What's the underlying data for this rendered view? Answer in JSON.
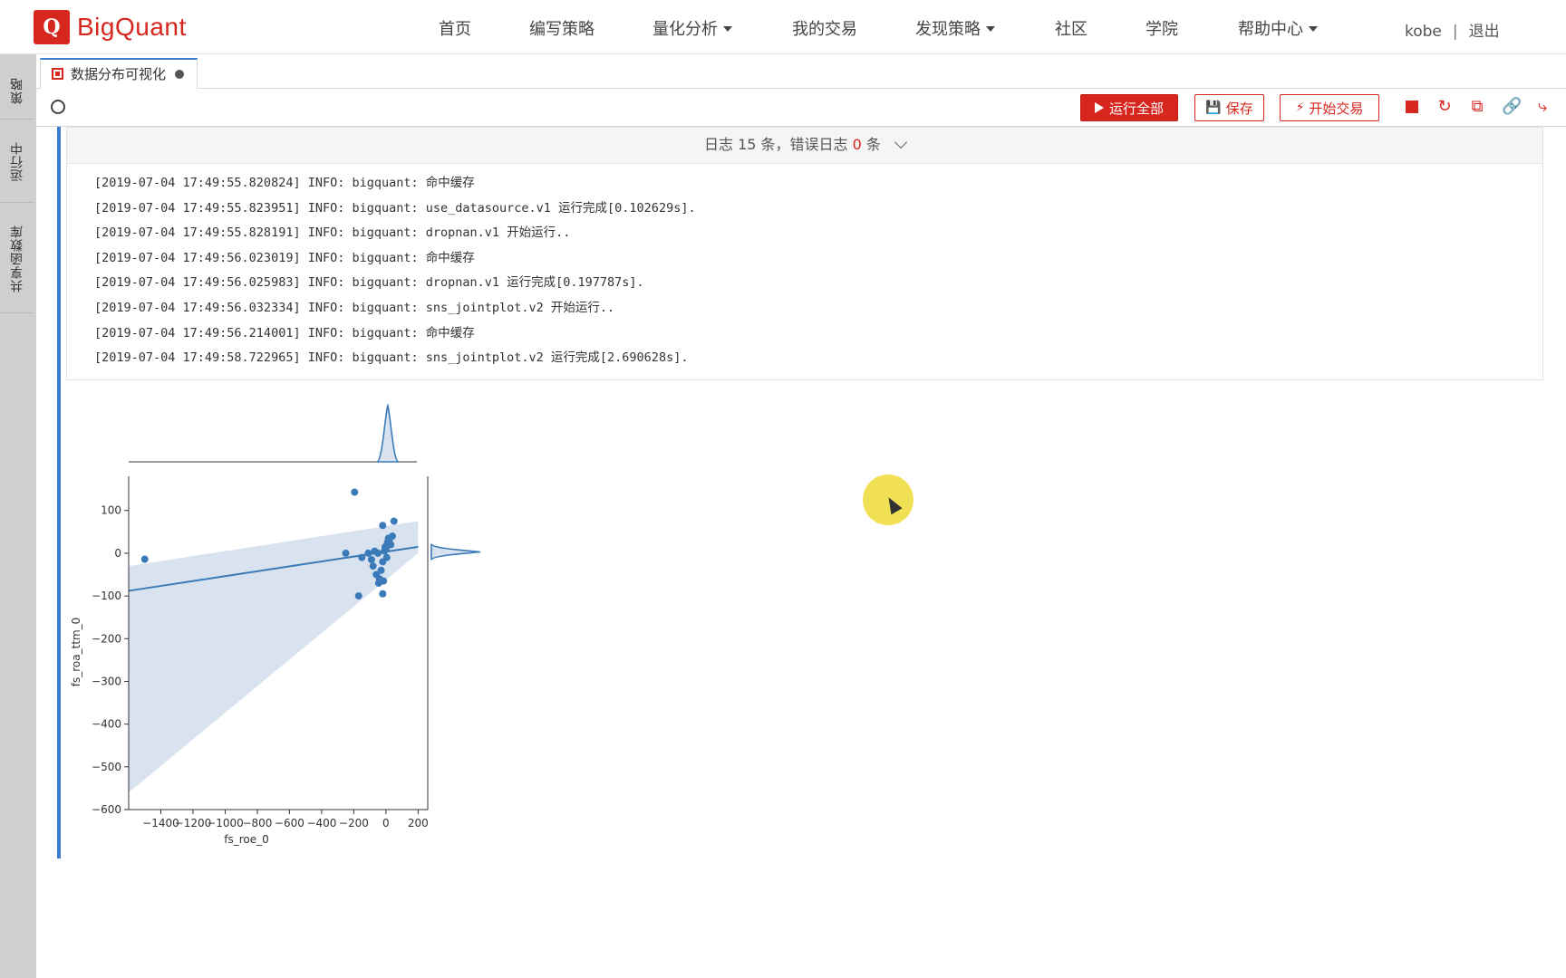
{
  "brand": {
    "logo_letter": "Q",
    "name": "BigQuant",
    "color": "#d7261e"
  },
  "nav": {
    "items": [
      {
        "label": "首页",
        "has_dropdown": false
      },
      {
        "label": "编写策略",
        "has_dropdown": false
      },
      {
        "label": "量化分析",
        "has_dropdown": true
      },
      {
        "label": "我的交易",
        "has_dropdown": false
      },
      {
        "label": "发现策略",
        "has_dropdown": true
      },
      {
        "label": "社区",
        "has_dropdown": false
      },
      {
        "label": "学院",
        "has_dropdown": false
      },
      {
        "label": "帮助中心",
        "has_dropdown": true
      }
    ],
    "user": "kobe",
    "separator": "|",
    "logout": "退出"
  },
  "sidebar": {
    "tabs": [
      {
        "label": "策略"
      },
      {
        "label": "运行中"
      },
      {
        "label": "共享函数库"
      }
    ]
  },
  "editor": {
    "tab_name": "数据分布可视化",
    "unsaved_dot": true
  },
  "toolbar": {
    "run_all": "运行全部",
    "save": "保存",
    "start_trade": "开始交易",
    "icons": [
      "stop-icon",
      "refresh-icon",
      "copy-icon",
      "link-icon",
      "share-icon"
    ]
  },
  "log": {
    "prefix": "日志",
    "count": "15",
    "count_unit": "条，错误日志",
    "error_count": "0",
    "error_unit": "条",
    "lines": [
      "[2019-07-04 17:49:55.820824] INFO: bigquant: 命中缓存",
      "[2019-07-04 17:49:55.823951] INFO: bigquant: use_datasource.v1 运行完成[0.102629s].",
      "[2019-07-04 17:49:55.828191] INFO: bigquant: dropnan.v1 开始运行..",
      "[2019-07-04 17:49:56.023019] INFO: bigquant: 命中缓存",
      "[2019-07-04 17:49:56.025983] INFO: bigquant: dropnan.v1 运行完成[0.197787s].",
      "[2019-07-04 17:49:56.032334] INFO: bigquant: sns_jointplot.v2 开始运行..",
      "[2019-07-04 17:49:56.214001] INFO: bigquant: 命中缓存",
      "[2019-07-04 17:49:58.722965] INFO: bigquant: sns_jointplot.v2 运行完成[2.690628s]."
    ]
  },
  "chart_data": {
    "type": "scatter",
    "xlabel": "fs_roe_0",
    "ylabel": "fs_roa_ttm_0",
    "xlim": [
      -1600,
      260
    ],
    "ylim": [
      -600,
      180
    ],
    "xticks": [
      -1400,
      -1200,
      -1000,
      -800,
      -600,
      -400,
      -200,
      0,
      200
    ],
    "yticks": [
      100,
      0,
      -100,
      -200,
      -300,
      -400,
      -500,
      -600
    ],
    "tick_labels_x": [
      "−1400",
      "−1200",
      "−1000",
      "−800",
      "−600",
      "−400",
      "−200",
      "0",
      "200"
    ],
    "tick_labels_y": [
      "100",
      "0",
      "−100",
      "−200",
      "−300",
      "−400",
      "−500",
      "−600"
    ],
    "points": [
      {
        "x": -1500,
        "y": -14
      },
      {
        "x": -195,
        "y": 143
      },
      {
        "x": -170,
        "y": -100
      },
      {
        "x": -20,
        "y": -95
      },
      {
        "x": 50,
        "y": 75
      },
      {
        "x": -20,
        "y": 65
      },
      {
        "x": -250,
        "y": 0
      },
      {
        "x": -150,
        "y": -10
      },
      {
        "x": -110,
        "y": 0
      },
      {
        "x": -80,
        "y": -30
      },
      {
        "x": -60,
        "y": -50
      },
      {
        "x": -40,
        "y": -60
      },
      {
        "x": -30,
        "y": -40
      },
      {
        "x": -20,
        "y": -20
      },
      {
        "x": -10,
        "y": 5
      },
      {
        "x": 0,
        "y": 10
      },
      {
        "x": 10,
        "y": 25
      },
      {
        "x": 20,
        "y": 30
      },
      {
        "x": 30,
        "y": 20
      },
      {
        "x": 5,
        "y": -10
      },
      {
        "x": -5,
        "y": 15
      },
      {
        "x": 15,
        "y": 35
      },
      {
        "x": -50,
        "y": 0
      },
      {
        "x": -70,
        "y": 5
      },
      {
        "x": -90,
        "y": -15
      },
      {
        "x": 40,
        "y": 40
      },
      {
        "x": -15,
        "y": -65
      },
      {
        "x": -45,
        "y": -70
      }
    ],
    "regression": {
      "x": [
        -1600,
        200
      ],
      "y": [
        -88,
        15
      ]
    },
    "ci_band": {
      "x": [
        -1600,
        200
      ],
      "upper": [
        -30,
        75
      ],
      "lower": [
        -560,
        0
      ]
    },
    "color": "#3a7ab8",
    "band_color": "#d9e3ef"
  }
}
